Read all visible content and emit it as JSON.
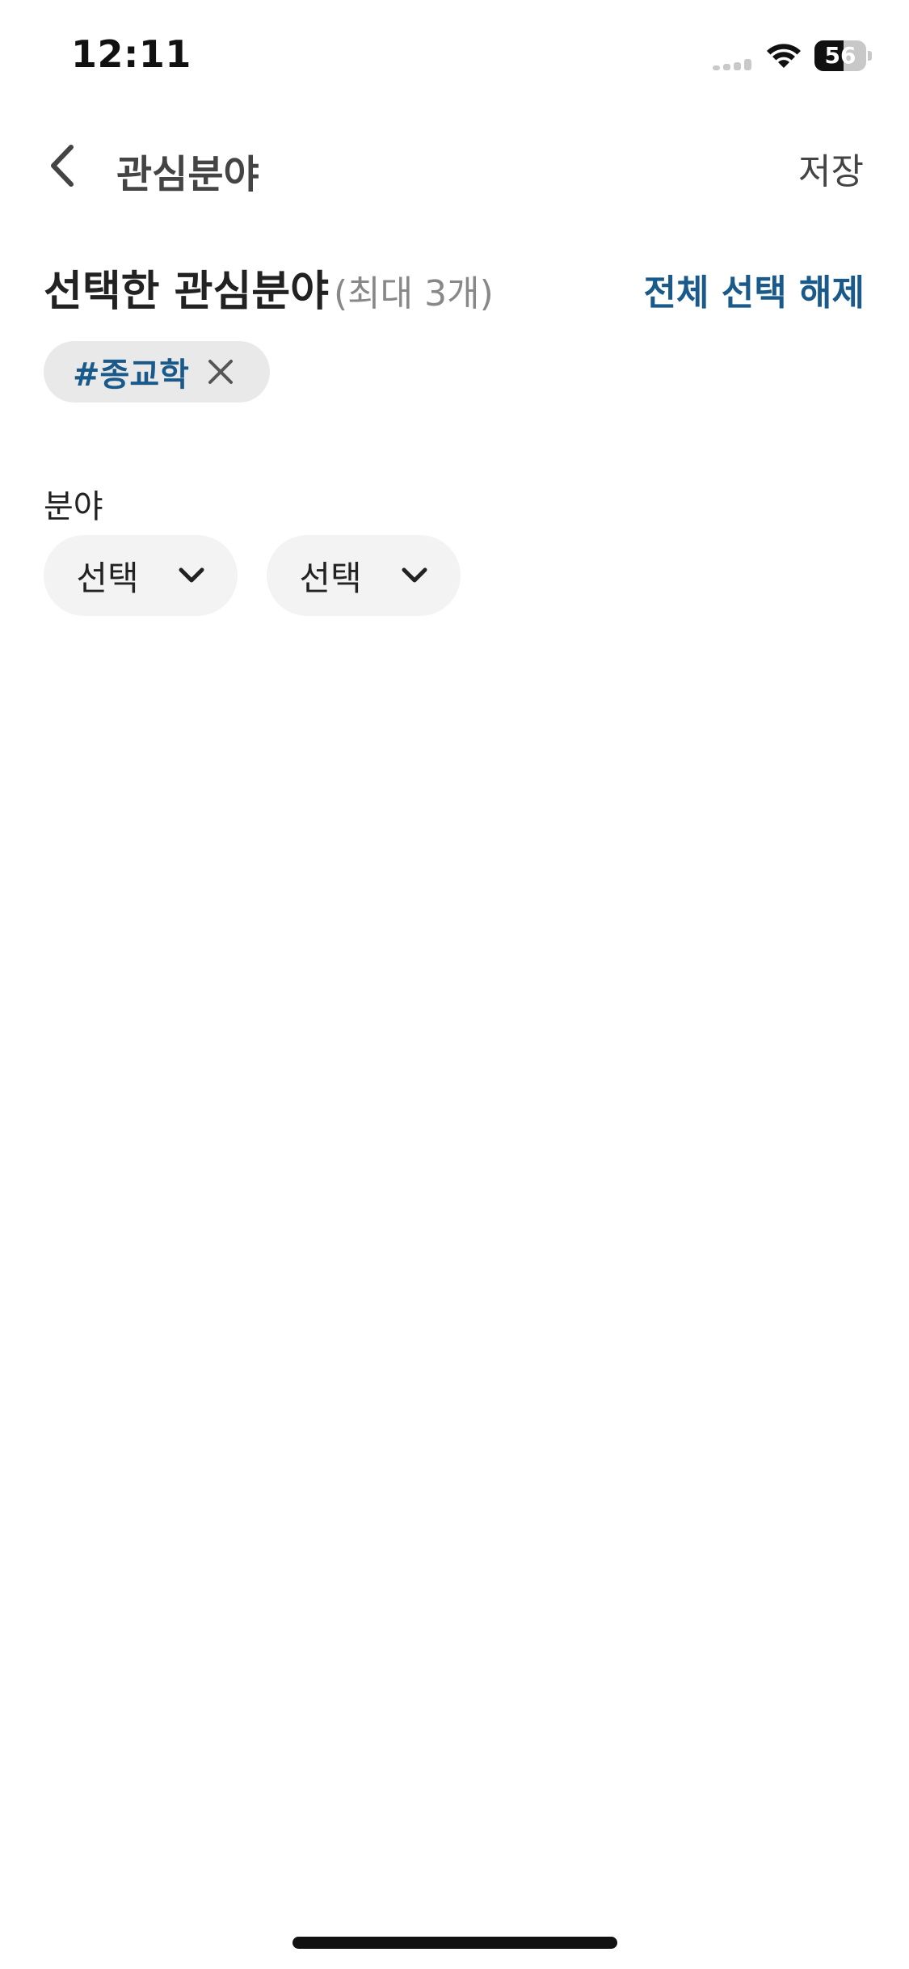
{
  "status_bar": {
    "time": "12:11",
    "battery_level": "56",
    "battery_fraction": 0.56,
    "icons": [
      "signal-icon",
      "wifi-icon",
      "battery-icon"
    ]
  },
  "header": {
    "back_icon": "chevron-left-icon",
    "title": "관심분야",
    "save_label": "저장"
  },
  "selected": {
    "title": "선택한 관심분야",
    "limit": "(최대 3개)",
    "clear_all_label": "전체 선택 해제",
    "tags": [
      {
        "label": "#종교학",
        "remove_icon": "close-icon"
      }
    ]
  },
  "field": {
    "label": "분야",
    "dropdowns": [
      {
        "label": "선택",
        "icon": "chevron-down-icon"
      },
      {
        "label": "선택",
        "icon": "chevron-down-icon"
      }
    ]
  },
  "colors": {
    "accent": "#1a5a8a",
    "chip_bg": "#e9e9e9",
    "dropdown_bg": "#f3f3f3",
    "text_primary": "#222222",
    "text_secondary": "#888888"
  }
}
